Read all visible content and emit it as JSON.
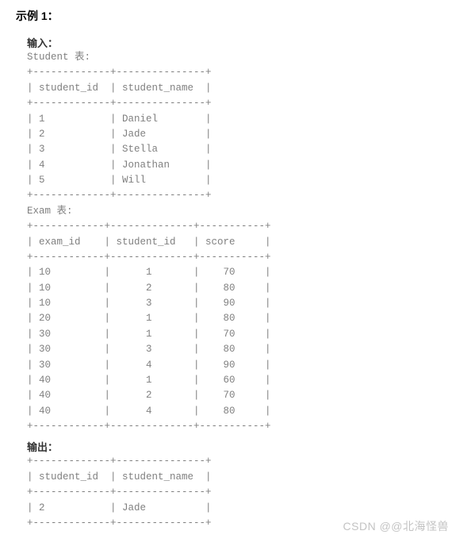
{
  "example_title": "示例 1：",
  "input_label": "输入：",
  "output_label": "输出：",
  "student_table": {
    "name": "Student 表:",
    "columns": [
      "student_id",
      "student_name"
    ],
    "rows": [
      [
        "1",
        "Daniel"
      ],
      [
        "2",
        "Jade"
      ],
      [
        "3",
        "Stella"
      ],
      [
        "4",
        "Jonathan"
      ],
      [
        "5",
        "Will"
      ]
    ]
  },
  "exam_table": {
    "name": "Exam 表:",
    "columns": [
      "exam_id",
      "student_id",
      "score"
    ],
    "rows": [
      [
        "10",
        "1",
        "70"
      ],
      [
        "10",
        "2",
        "80"
      ],
      [
        "10",
        "3",
        "90"
      ],
      [
        "20",
        "1",
        "80"
      ],
      [
        "30",
        "1",
        "70"
      ],
      [
        "30",
        "3",
        "80"
      ],
      [
        "30",
        "4",
        "90"
      ],
      [
        "40",
        "1",
        "60"
      ],
      [
        "40",
        "2",
        "70"
      ],
      [
        "40",
        "4",
        "80"
      ]
    ]
  },
  "output_table": {
    "columns": [
      "student_id",
      "student_name"
    ],
    "rows": [
      [
        "2",
        "Jade"
      ]
    ]
  },
  "watermark": "CSDN @@北海怪兽"
}
